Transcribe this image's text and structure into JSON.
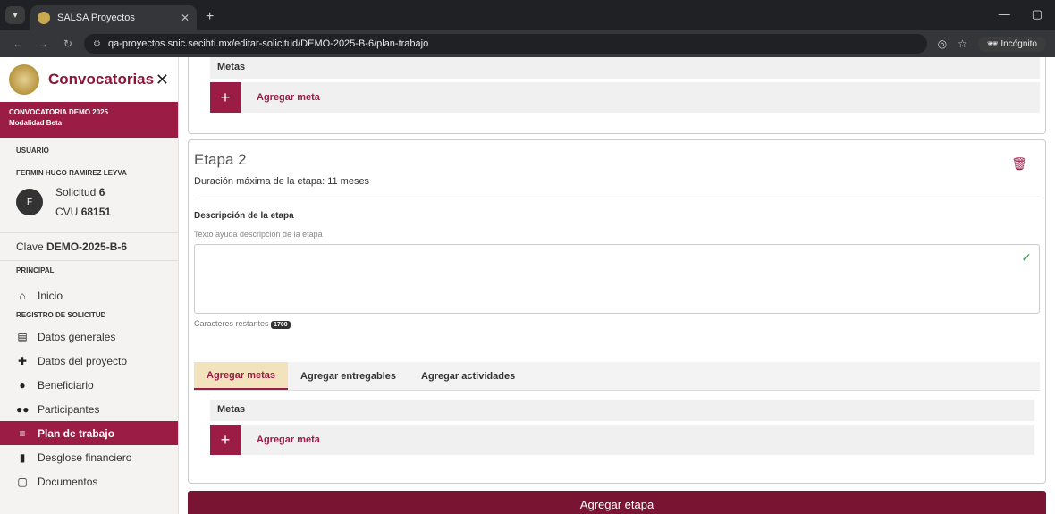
{
  "browser": {
    "tab_title": "SALSA Proyectos",
    "url": "qa-proyectos.snic.secihti.mx/editar-solicitud/DEMO-2025-B-6/plan-trabajo",
    "incognito_label": "Incógnito"
  },
  "sidebar": {
    "title": "Convocatorias",
    "convocatoria": "CONVOCATORIA DEMO 2025",
    "modalidad": "Modalidad Beta",
    "section_user": "USUARIO",
    "user_name": "FERMIN HUGO RAMIREZ LEYVA",
    "avatar_initial": "F",
    "solicitud_label": "Solicitud",
    "solicitud_value": "6",
    "cvu_label": "CVU",
    "cvu_value": "68151",
    "clave_label": "Clave",
    "clave_value": "DEMO-2025-B-6",
    "section_principal": "PRINCIPAL",
    "inicio": "Inicio",
    "section_registro": "REGISTRO DE SOLICITUD",
    "items": [
      {
        "label": "Datos generales",
        "icon": "document-icon"
      },
      {
        "label": "Datos del proyecto",
        "icon": "puzzle-icon"
      },
      {
        "label": "Beneficiario",
        "icon": "user-icon"
      },
      {
        "label": "Participantes",
        "icon": "users-icon"
      },
      {
        "label": "Plan de trabajo",
        "icon": "list-icon"
      },
      {
        "label": "Desglose financiero",
        "icon": "bar-chart-icon"
      },
      {
        "label": "Documentos",
        "icon": "square-icon"
      }
    ]
  },
  "main": {
    "metas_header": "Metas",
    "add_meta": "Agregar meta",
    "etapa_title": "Etapa 2",
    "duracion": "Duración máxima de la etapa: 11 meses",
    "desc_label": "Descripción de la etapa",
    "desc_help": "Texto ayuda descripción de la etapa",
    "chars_label": "Caracteres restantes",
    "chars_value": "1700",
    "tabs": [
      "Agregar metas",
      "Agregar entregables",
      "Agregar actividades"
    ],
    "add_etapa": "Agregar etapa"
  }
}
